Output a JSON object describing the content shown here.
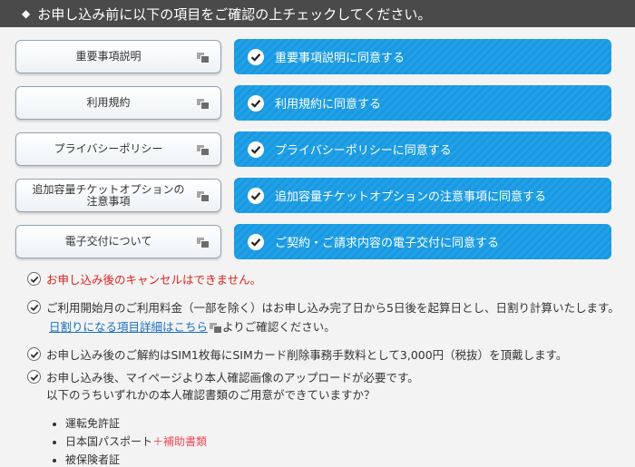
{
  "header": {
    "title": "お申し込み前に以下の項目をご確認の上チェックしてください。"
  },
  "rows": [
    {
      "doc": "重要事項説明",
      "agree": "重要事項説明に同意する"
    },
    {
      "doc": "利用規約",
      "agree": "利用規約に同意する"
    },
    {
      "doc": "プライバシーポリシー",
      "agree": "プライバシーポリシーに同意する"
    },
    {
      "doc": "追加容量チケットオプションの注意事項",
      "agree": "追加容量チケットオプションの注意事項に同意する"
    },
    {
      "doc": "電子交付について",
      "agree": "ご契約・ご請求内容の電子交付に同意する"
    }
  ],
  "notes": {
    "cancel": "お申し込み後のキャンセルはできません。",
    "billing": "ご利用開始月のご利用料金（一部を除く）はお申し込み完了日から5日後を起算日とし、日割り計算いたします。",
    "prorate_link": "日割りになる項目詳細はこちら",
    "prorate_after": "よりご確認ください。",
    "cancel_fee": "お申し込み後のご解約はSIM1枚毎にSIMカード削除事務手数料として3,000円（税抜）を頂戴します。",
    "id_line1": "お申し込み後、マイページより本人確認画像のアップロードが必要です。",
    "id_line2": "以下のうちいずれかの本人確認書類のご用意ができていますか？",
    "id_docs": [
      "運転免許証",
      "日本国パスポート",
      "被保険者証"
    ],
    "passport_extra": "＋補助書類"
  }
}
